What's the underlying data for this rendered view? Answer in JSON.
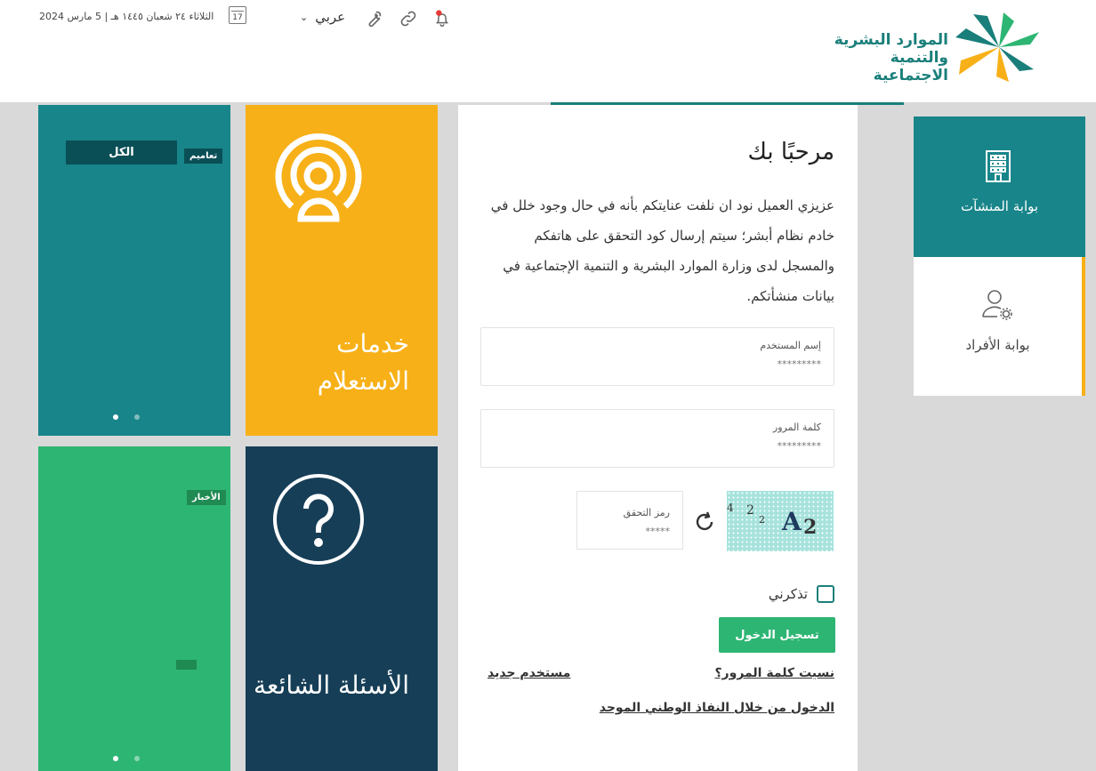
{
  "header": {
    "date": "الثلاثاء ٢٤ شعبان ١٤٤٥ هـ | 5 مارس 2024",
    "calendar_day": "17",
    "language": "عربي",
    "logo_text": "الموارد البشرية والتنمية الاجتماعية",
    "icons": [
      "calendar-icon",
      "chevron-down-icon",
      "wrench-icon",
      "link-icon",
      "bell-icon"
    ]
  },
  "tiles": {
    "all_label": "الكل",
    "tag_circulars": "تعاميم",
    "tag_news": "الأخبار",
    "inquiry_title": "خدمات الاستعلام",
    "faq_title": "الأسئلة الشائعة"
  },
  "login": {
    "welcome": "مرحبًا بك",
    "intro": "عزيزي العميل نود ان نلفت عنايتكم بأنه في حال وجود خلل في خادم نظام أبشر؛ سيتم إرسال كود التحقق على هاتفكم والمسجل لدى وزارة الموارد البشرية و التنمية الإجتماعية في بيانات منشأتكم.",
    "username_label": "إسم المستخدم",
    "username_placeholder": "*********",
    "password_label": "كلمة المرور",
    "password_placeholder": "*********",
    "captcha_label": "رمز التحقق",
    "captcha_placeholder": "*****",
    "remember_label": "تذكرني",
    "login_button": "تسجيل الدخول",
    "forgot_password": "نسيت كلمة المرور؟",
    "new_user": "مستخدم جديد",
    "nafath_login": "الدخول من خلال النفاذ الوطني الموحد"
  },
  "side": {
    "establishments": "بوابة المنشآت",
    "individuals": "بوابة الأفراد"
  },
  "colors": {
    "teal": "#18858a",
    "yellow": "#f7b017",
    "green": "#2db573",
    "navy": "#163e57"
  }
}
